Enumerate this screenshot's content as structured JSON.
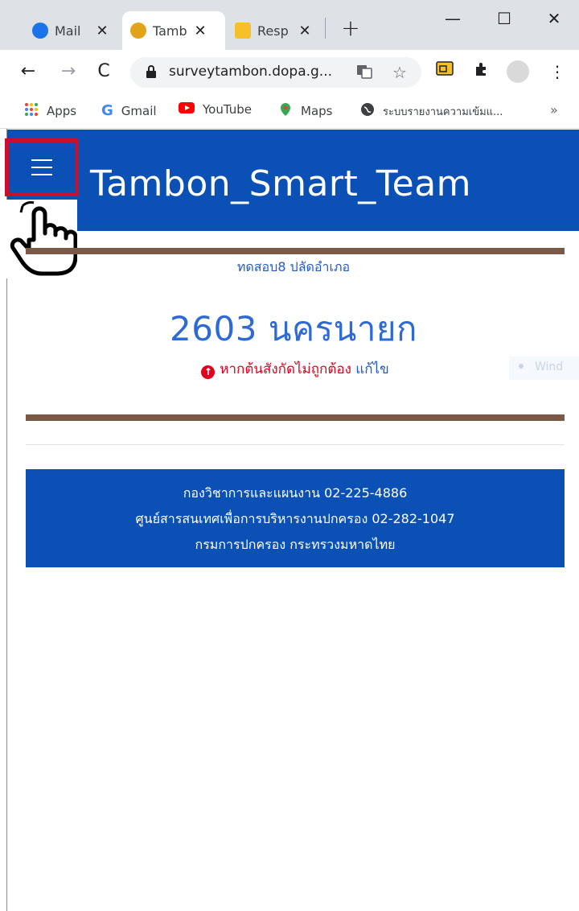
{
  "browser": {
    "tabs": [
      {
        "label": "Mail",
        "active": false,
        "favicon_color": "#1a73e8"
      },
      {
        "label": "Tamb",
        "active": true,
        "favicon_color": "#e2a31a"
      },
      {
        "label": "Resp",
        "active": false,
        "favicon_color": "#f6c02a"
      }
    ],
    "new_tab_label": "+",
    "window_controls": {
      "minimize": "—",
      "maximize": "☐",
      "close": "✕"
    },
    "url": "surveytambon.dopa.g...",
    "bookmarks": [
      {
        "label": "Apps",
        "icon": "apps-grid-icon"
      },
      {
        "label": "Gmail",
        "icon": "google-g-icon"
      },
      {
        "label": "YouTube",
        "icon": "youtube-icon"
      },
      {
        "label": "Maps",
        "icon": "maps-pin-icon"
      },
      {
        "label": "ระบบรายงานความเข้มแ...",
        "icon": "globe-icon"
      }
    ],
    "bookmarks_overflow": "»"
  },
  "page": {
    "site_title": "Tambon_Smart_Team",
    "subtitle": "ทดสอบ8 ปลัดอำเภอ",
    "main_title": "2603 นครนายก",
    "warning_text": "หากต้นสังกัดไม่ถูกต้อง",
    "edit_link": "แก้ไข",
    "watermark": "Wind",
    "footer": {
      "line1": "กองวิชาการและแผนงาน 02-225-4886",
      "line2": "ศูนย์สารสนเทศเพื่อการบริหารงานปกครอง 02-282-1047",
      "line3": "กรมการปกครอง กระทรวงมหาดไทย"
    }
  },
  "colors": {
    "header_blue": "#0b50b4",
    "highlight_red": "#c8102e",
    "divider_brown": "#7a5a47",
    "warning_red": "#e0001b",
    "title_blue": "#2d6ad6"
  }
}
